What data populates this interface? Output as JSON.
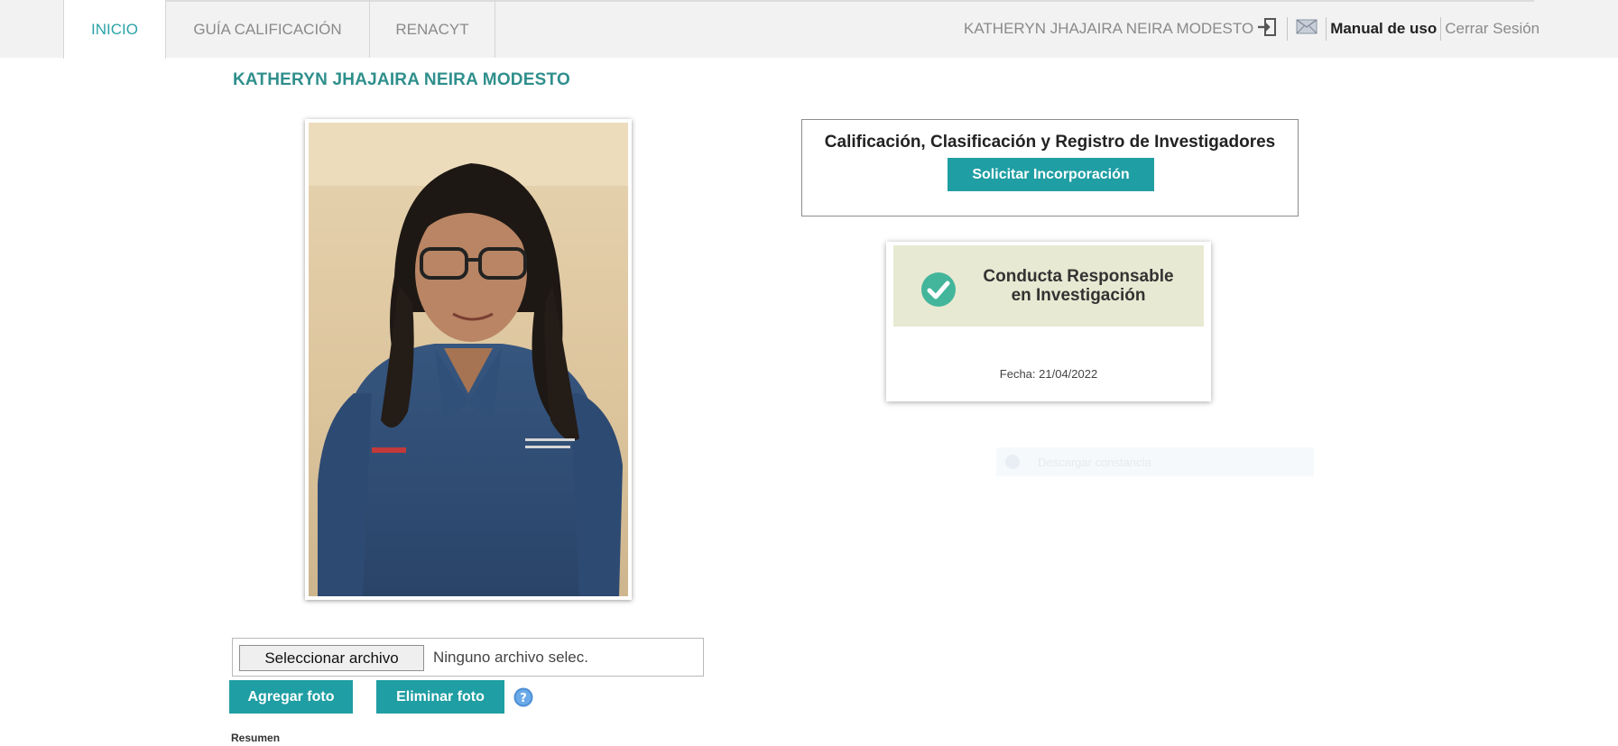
{
  "nav": {
    "tabs": [
      {
        "label": "INICIO",
        "active": true
      },
      {
        "label": "GUÍA CALIFICACIÓN",
        "active": false
      },
      {
        "label": "RENACYT",
        "active": false
      }
    ],
    "user_name": "KATHERYN JHAJAIRA NEIRA MODESTO",
    "manual_label": "Manual de uso",
    "logout_label": "Cerrar Sesión",
    "icons": [
      "login-icon",
      "mail-icon"
    ]
  },
  "profile": {
    "name": "KATHERYN JHAJAIRA NEIRA MODESTO"
  },
  "renacyt": {
    "title": "Calificación, Clasificación y Registro de Investigadores",
    "button_label": "Solicitar Incorporación"
  },
  "crei": {
    "line1": "Conducta Responsable",
    "line2": "en Investigación",
    "date": "Fecha: 21/04/2022",
    "icon": "check-circle-icon"
  },
  "ghost": {
    "text": "Descargar constancia"
  },
  "photo_upload": {
    "select_button": "Seleccionar archivo",
    "status": "Ninguno archivo selec.",
    "add_button": "Agregar foto",
    "delete_button": "Eliminar foto",
    "help_icon": "help-icon"
  },
  "summary_label": "Resumen",
  "colors": {
    "accent": "#1f9ea3",
    "title_teal": "#2f8f8c",
    "crei_banner": "#e8e9d2",
    "check_green": "#43b59b"
  }
}
